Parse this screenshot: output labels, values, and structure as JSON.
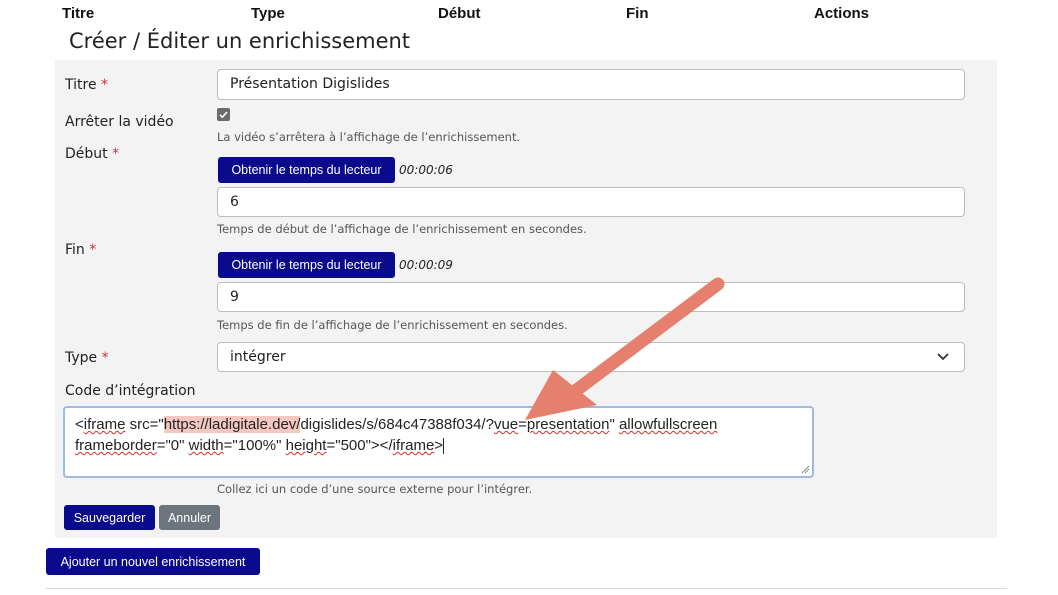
{
  "table_header": {
    "col_title": "Titre",
    "col_type": "Type",
    "col_start": "Début",
    "col_end": "Fin",
    "col_actions": "Actions"
  },
  "form": {
    "heading": "Créer / Éditer un enrichissement",
    "required_marker": "*",
    "title_label": "Titre",
    "title_value": "Présentation Digislides",
    "stop_video_label": "Arrêter la vidéo",
    "stop_video_checked": true,
    "stop_video_help": "La vidéo s’arrêtera à l’affichage de l’enrichissement.",
    "start_label": "Début",
    "start_button": "Obtenir le temps du lecteur",
    "start_time": "00:00:06",
    "start_value": "6",
    "start_help": "Temps de début de l’affichage de l’enrichissement en secondes.",
    "end_label": "Fin",
    "end_button": "Obtenir le temps du lecteur",
    "end_time": "00:00:09",
    "end_value": "9",
    "end_help": "Temps de fin de l’affichage de l’enrichissement en secondes.",
    "type_label": "Type",
    "type_value": "intégrer",
    "embed_label": "Code d’intégration",
    "embed_code": {
      "p1": "<",
      "p2": "iframe",
      "p3": " src=\"",
      "url_highlight": "https://ladigitale.dev/",
      "p4": "digislides/s/684c47388f034/?",
      "p5": "vue",
      "p6": "=",
      "p7": "presentation",
      "p8": "\" ",
      "p9": "allowfullscreen",
      "p10": "frameborder",
      "p11": "=\"0\" ",
      "p12": "width",
      "p13": "=\"100%\" ",
      "p14": "height",
      "p15": "=\"500\"></",
      "p16": "iframe",
      "p17": ">"
    },
    "embed_help": "Collez ici un code d’une source externe pour l’intégrer.",
    "save_button": "Sauvegarder",
    "cancel_button": "Annuler"
  },
  "add_button": "Ajouter un nouvel enrichissement",
  "colors": {
    "primary": "#0a0a8c",
    "secondary": "#6c757d",
    "required": "#d32f2f",
    "annotation_arrow": "#e5806f",
    "url_highlight": "#f4c8c0"
  },
  "icons": {
    "checkbox": "check-icon",
    "select": "chevron-down-icon",
    "resize": "resize-handle-icon",
    "annotation": "annotation-arrow-icon"
  }
}
